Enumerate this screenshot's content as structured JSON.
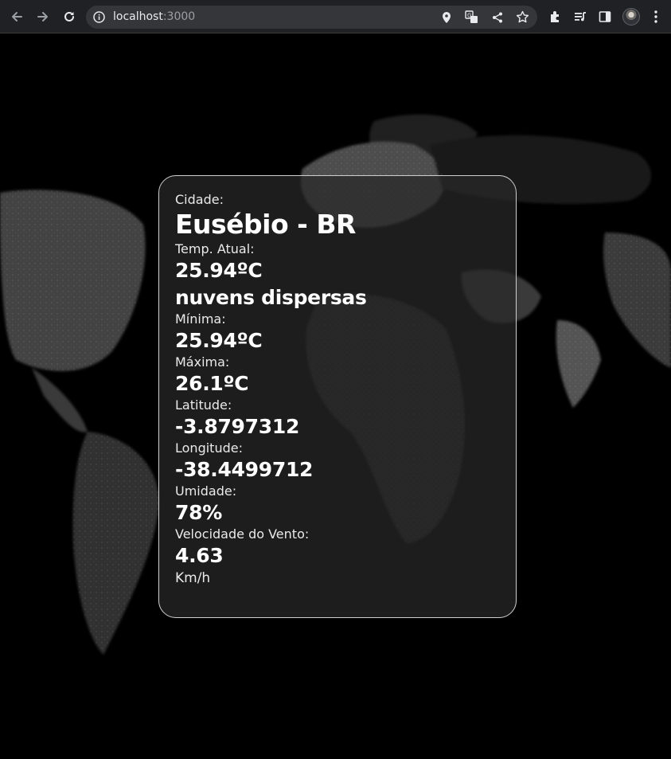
{
  "browser": {
    "url_host": "localhost",
    "url_port": ":3000",
    "icons": [
      "back-icon",
      "forward-icon",
      "reload-icon",
      "site-info-icon",
      "location-icon",
      "translate-icon",
      "share-icon",
      "bookmark-star-icon",
      "extensions-icon",
      "media-queue-icon",
      "side-panel-icon",
      "profile-avatar",
      "menu-kebab-icon"
    ]
  },
  "weather": {
    "city_label": "Cidade:",
    "city": "Eusébio - BR",
    "temp_label": "Temp. Atual:",
    "temp": "25.94ºC",
    "description": "nuvens dispersas",
    "min_label": "Mínima:",
    "min": "25.94ºC",
    "max_label": "Máxima:",
    "max": "26.1ºC",
    "lat_label": "Latitude:",
    "lat": "-3.8797312",
    "lon_label": "Longitude:",
    "lon": "-38.4499712",
    "humidity_label": "Umidade:",
    "humidity": "78%",
    "wind_label": "Velocidade do Vento:",
    "wind": "4.63",
    "wind_unit": "Km/h"
  },
  "colors": {
    "chrome_bg": "#202124",
    "omnibox_bg": "#35363a",
    "page_bg": "#000000",
    "card_border": "#cfcfcf",
    "text": "#ffffff"
  }
}
